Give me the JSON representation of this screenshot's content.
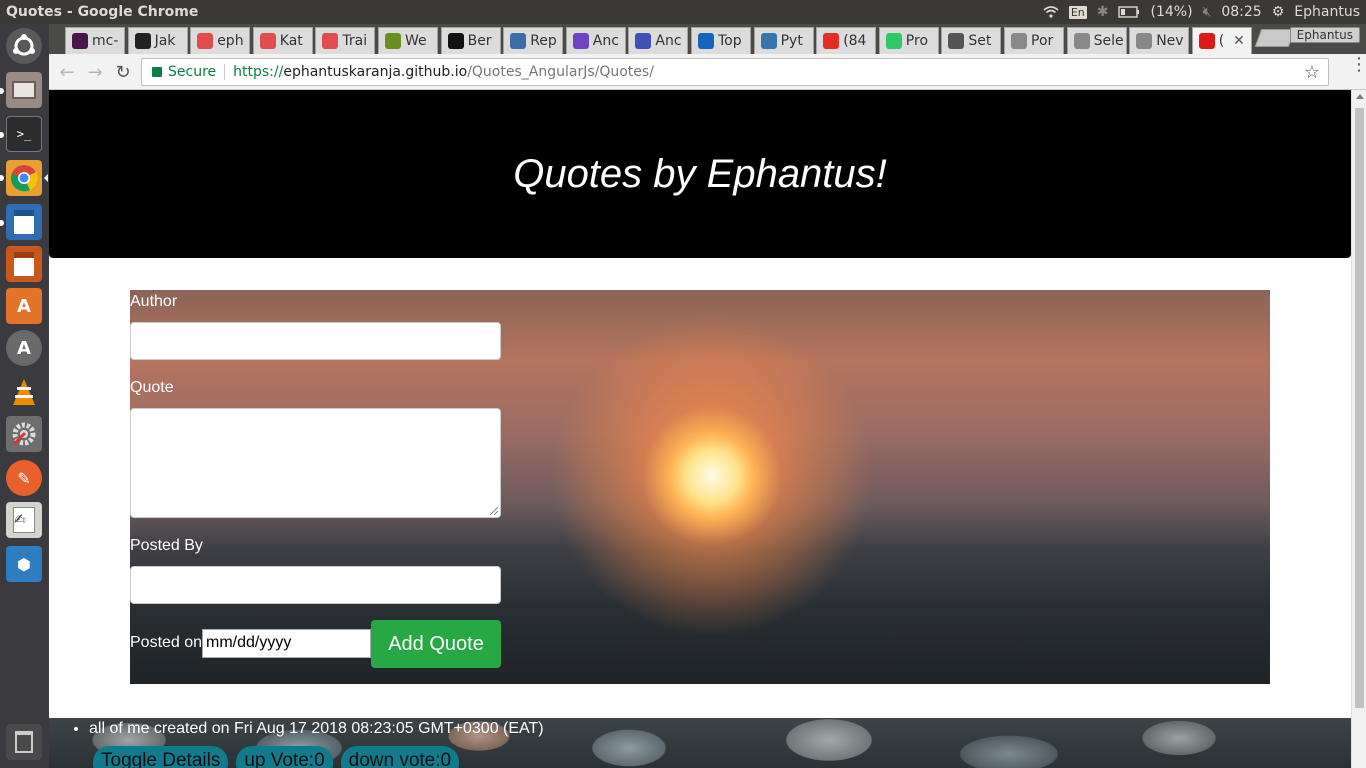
{
  "system": {
    "window_title": "Quotes - Google Chrome",
    "keyboard": "En",
    "battery": "(14%)",
    "time": "08:25",
    "user": "Ephantus"
  },
  "browser": {
    "tabs": [
      {
        "label": "mc-",
        "icon": "hash-icon",
        "color": "#4a154b"
      },
      {
        "label": "Jak",
        "icon": "square-icon",
        "color": "#222222"
      },
      {
        "label": "eph",
        "icon": "codepen-icon",
        "color": "#e34c4c"
      },
      {
        "label": "Kat",
        "icon": "codepen-icon",
        "color": "#e34c4c"
      },
      {
        "label": "Trai",
        "icon": "codepen-icon",
        "color": "#e34c4c"
      },
      {
        "label": "We",
        "icon": "tree-icon",
        "color": "#6b8e23"
      },
      {
        "label": "Ber",
        "icon": "github-icon",
        "color": "#111111"
      },
      {
        "label": "Rep",
        "icon": "circle-icon",
        "color": "#3a6ea5"
      },
      {
        "label": "Anc",
        "icon": "list-icon",
        "color": "#6f42c1"
      },
      {
        "label": "Anc",
        "icon": "gear-icon",
        "color": "#3f51b5"
      },
      {
        "label": "Top",
        "icon": "e-icon",
        "color": "#1565c0"
      },
      {
        "label": "Pyt",
        "icon": "python-icon",
        "color": "#3776ab"
      },
      {
        "label": "(84",
        "icon": "youtube-icon",
        "color": "#e52d27"
      },
      {
        "label": "Pro",
        "icon": "h-icon",
        "color": "#2ec866"
      },
      {
        "label": "Set",
        "icon": "gear-icon",
        "color": "#555555"
      },
      {
        "label": "Por",
        "icon": "page-icon",
        "color": "#888888"
      },
      {
        "label": "Sele",
        "icon": "page-icon",
        "color": "#888888"
      },
      {
        "label": "Nev",
        "icon": "page-icon",
        "color": "#888888"
      },
      {
        "label": "(",
        "icon": "angular-icon",
        "color": "#dd1b16",
        "active": true
      }
    ],
    "profile": "Ephantus",
    "secure_label": "Secure",
    "url_scheme": "https://",
    "url_host": "ephantuskaranja.github.io",
    "url_path": "/Quotes_AngularJs/Quotes/"
  },
  "page": {
    "title": "Quotes by Ephantus!",
    "form": {
      "author_label": "Author",
      "quote_label": "Quote",
      "posted_by_label": "Posted By",
      "posted_on_label": "Posted on",
      "date_placeholder": "mm/dd/yyyy",
      "add_button": "Add Quote"
    },
    "quotes": [
      {
        "summary": "all of me created on Fri Aug 17 2018 08:23:05 GMT+0300 (EAT)",
        "toggle": "Toggle Details",
        "upvote": "up Vote:0",
        "downvote": "down vote:0"
      }
    ]
  }
}
